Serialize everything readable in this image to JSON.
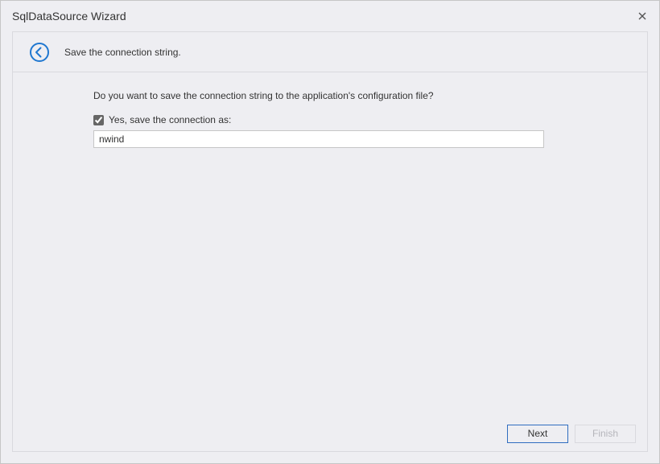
{
  "window": {
    "title": "SqlDataSource Wizard"
  },
  "header": {
    "step_title": "Save the connection string."
  },
  "content": {
    "question": "Do you want to save the connection string to the application's configuration file?",
    "checkbox_label": "Yes, save the connection as:",
    "checkbox_checked": true,
    "connection_name": "nwind"
  },
  "footer": {
    "next_label": "Next",
    "finish_label": "Finish"
  }
}
